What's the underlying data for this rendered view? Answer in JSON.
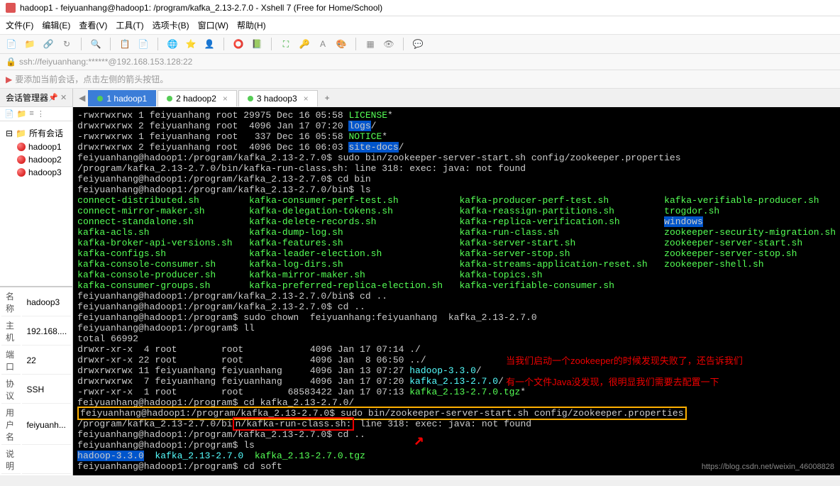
{
  "titlebar": {
    "title": "hadoop1 - feiyuanhang@hadoop1: /program/kafka_2.13-2.7.0 - Xshell 7 (Free for Home/School)"
  },
  "menu": {
    "file": "文件(F)",
    "edit": "编辑(E)",
    "view": "查看(V)",
    "tools": "工具(T)",
    "tab": "选项卡(B)",
    "window": "窗口(W)",
    "help": "帮助(H)"
  },
  "address": "ssh://feiyuanhang:******@192.168.153.128:22",
  "hint": "要添加当前会话，点击左侧的箭头按钮。",
  "sidebar": {
    "title": "会话管理器",
    "root": "所有会话",
    "sessions": [
      "hadoop1",
      "hadoop2",
      "hadoop3"
    ]
  },
  "props": {
    "name_label": "名称",
    "name_value": "hadoop3",
    "host_label": "主机",
    "host_value": "192.168....",
    "port_label": "端口",
    "port_value": "22",
    "proto_label": "协议",
    "proto_value": "SSH",
    "user_label": "用户名",
    "user_value": "feiyuanh...",
    "desc_label": "说明",
    "desc_value": ""
  },
  "tabs": {
    "t1": "1 hadoop1",
    "t2": "2 hadoop2",
    "t3": "3 hadoop3"
  },
  "terminal": {
    "l1a": "-rwxrwxrwx 1 feiyuanhang root 29975 Dec 16 05:58 ",
    "l1b": "LICENSE",
    "l1c": "*",
    "l2a": "drwxrwxrwx 2 feiyuanhang root  4096 Jan 17 07:20 ",
    "l2b": "logs",
    "l2c": "/",
    "l3a": "-rwxrwxrwx 1 feiyuanhang root   337 Dec 16 05:58 ",
    "l3b": "NOTICE",
    "l3c": "*",
    "l4a": "drwxrwxrwx 2 feiyuanhang root  4096 Dec 16 06:03 ",
    "l4b": "site-docs",
    "l4c": "/",
    "l5": "feiyuanhang@hadoop1:/program/kafka_2.13-2.7.0$ sudo bin/zookeeper-server-start.sh config/zookeeper.properties",
    "l6": "/program/kafka_2.13-2.7.0/bin/kafka-run-class.sh: line 318: exec: java: not found",
    "l7": "feiyuanhang@hadoop1:/program/kafka_2.13-2.7.0$ cd bin",
    "l8": "feiyuanhang@hadoop1:/program/kafka_2.13-2.7.0/bin$ ls",
    "c1_1": "connect-distributed.sh",
    "c1_2": "kafka-consumer-perf-test.sh",
    "c1_3": "kafka-producer-perf-test.sh",
    "c1_4": "kafka-verifiable-producer.sh",
    "c2_1": "connect-mirror-maker.sh",
    "c2_2": "kafka-delegation-tokens.sh",
    "c2_3": "kafka-reassign-partitions.sh",
    "c2_4": "trogdor.sh",
    "c3_1": "connect-standalone.sh",
    "c3_2": "kafka-delete-records.sh",
    "c3_3": "kafka-replica-verification.sh",
    "c3_4": "windows",
    "c4_1": "kafka-acls.sh",
    "c4_2": "kafka-dump-log.sh",
    "c4_3": "kafka-run-class.sh",
    "c4_4": "zookeeper-security-migration.sh",
    "c5_1": "kafka-broker-api-versions.sh",
    "c5_2": "kafka-features.sh",
    "c5_3": "kafka-server-start.sh",
    "c5_4": "zookeeper-server-start.sh",
    "c6_1": "kafka-configs.sh",
    "c6_2": "kafka-leader-election.sh",
    "c6_3": "kafka-server-stop.sh",
    "c6_4": "zookeeper-server-stop.sh",
    "c7_1": "kafka-console-consumer.sh",
    "c7_2": "kafka-log-dirs.sh",
    "c7_3": "kafka-streams-application-reset.sh",
    "c7_4": "zookeeper-shell.sh",
    "c8_1": "kafka-console-producer.sh",
    "c8_2": "kafka-mirror-maker.sh",
    "c8_3": "kafka-topics.sh",
    "c9_1": "kafka-consumer-groups.sh",
    "c9_2": "kafka-preferred-replica-election.sh",
    "c9_3": "kafka-verifiable-consumer.sh",
    "l20": "feiyuanhang@hadoop1:/program/kafka_2.13-2.7.0/bin$ cd ..",
    "l21": "feiyuanhang@hadoop1:/program/kafka_2.13-2.7.0$ cd ..",
    "l22": "feiyuanhang@hadoop1:/program$ sudo chown  feiyuanhang:feiyuanhang  kafka_2.13-2.7.0",
    "l23": "feiyuanhang@hadoop1:/program$ ll",
    "l24": "total 66992",
    "l25": "drwxr-xr-x  4 root        root            4096 Jan 17 07:14 ./",
    "l26": "drwxr-xr-x 22 root        root            4096 Jan  8 06:50 ../",
    "l27a": "drwxrwxrwx 11 feiyuanhang feiyuanhang     4096 Jan 13 07:27 ",
    "l27b": "hadoop-3.3.0",
    "l27c": "/",
    "l28a": "drwxrwxrwx  7 feiyuanhang feiyuanhang     4096 Jan 17 07:20 ",
    "l28b": "kafka_2.13-2.7.0",
    "l28c": "/",
    "l29a": "-rwxr-xr-x  1 root        root        68583422 Jan 17 07:13 ",
    "l29b": "kafka_2.13-2.7.0.tgz",
    "l29c": "*",
    "l30": "feiyuanhang@hadoop1:/program$ cd kafka_2.13-2.7.0/",
    "l31a": "feiyuanhang@hadoop1:/program/kafka_2.13-2.7.0$ ",
    "l31b": "sudo bin/zookeeper-server-start.sh config/zookeeper.properties",
    "l32a": "/program/kafka_2.13-2.7.0/bi",
    "l32b": "n/kafka-run-class.sh:",
    "l32c": " line 318: exec: java: not found",
    "l33": "feiyuanhang@hadoop1:/program/kafka_2.13-2.7.0$ cd ..",
    "l34": "feiyuanhang@hadoop1:/program$ ls",
    "l35a": "hadoop-3.3.0",
    "l35b": "kafka_2.13-2.7.0",
    "l35c": "kafka_2.13-2.7.0.tgz",
    "l36": "feiyuanhang@hadoop1:/program$ cd soft"
  },
  "annotation": {
    "line1": "当我们启动一个zookeeper的时候发现失败了，还告诉我们",
    "line2": "有一个文件Java没发现，很明显我们需要去配置一下"
  },
  "watermark": "https://blog.csdn.net/weixin_46008828"
}
